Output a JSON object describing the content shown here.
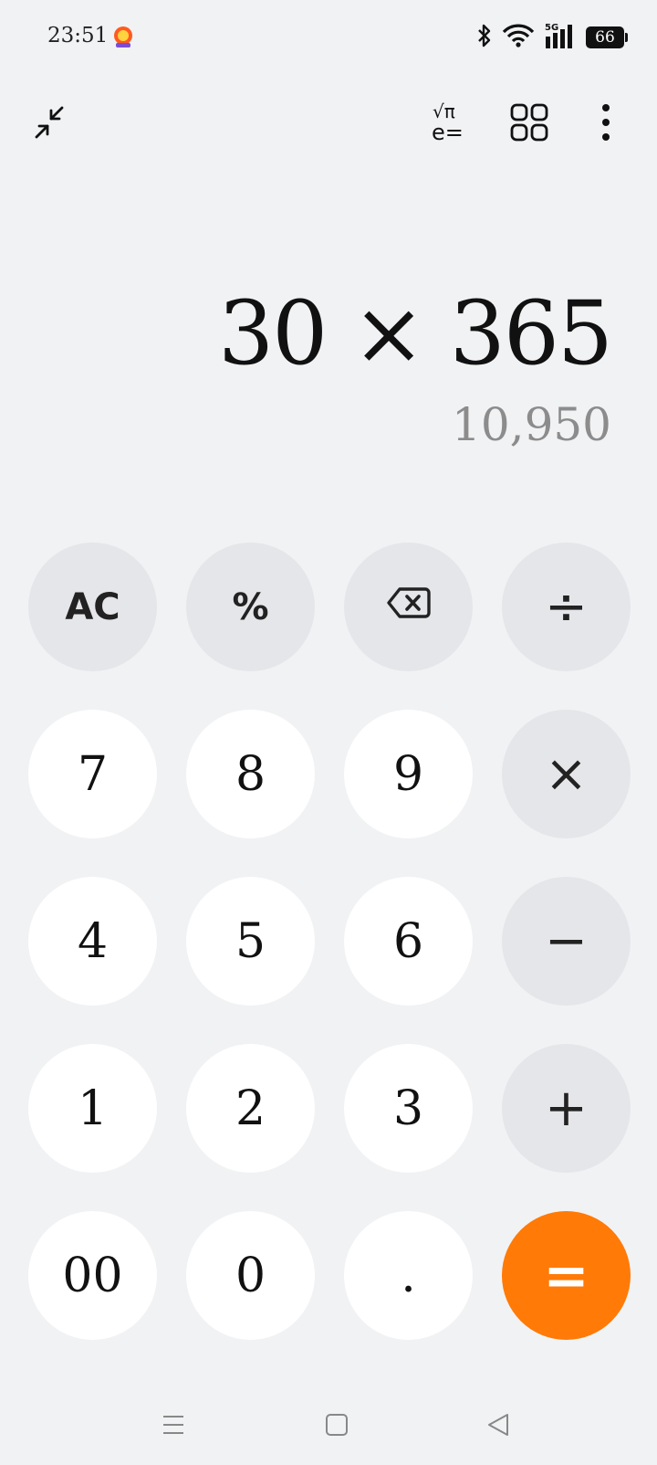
{
  "status_bar": {
    "time": "23:51",
    "battery": "66",
    "network": "5G",
    "icons": [
      "app-notification-icon",
      "bluetooth-icon",
      "wifi-icon",
      "signal-icon",
      "battery-icon"
    ]
  },
  "toolbar": {
    "icons": [
      "collapse-icon",
      "scientific-mode-icon",
      "converter-grid-icon",
      "more-options-icon"
    ],
    "sci_top": "√π",
    "sci_bottom": "e="
  },
  "display": {
    "expression": "30 × 365",
    "result": "10,950"
  },
  "keypad": {
    "keys": [
      {
        "label": "AC",
        "type": "func",
        "name": "clear"
      },
      {
        "label": "%",
        "type": "func",
        "name": "percent"
      },
      {
        "label": "",
        "type": "func",
        "name": "backspace",
        "icon": "backspace-icon"
      },
      {
        "label": "÷",
        "type": "op",
        "name": "divide"
      },
      {
        "label": "7",
        "type": "num",
        "name": "digit-7"
      },
      {
        "label": "8",
        "type": "num",
        "name": "digit-8"
      },
      {
        "label": "9",
        "type": "num",
        "name": "digit-9"
      },
      {
        "label": "×",
        "type": "op",
        "name": "multiply"
      },
      {
        "label": "4",
        "type": "num",
        "name": "digit-4"
      },
      {
        "label": "5",
        "type": "num",
        "name": "digit-5"
      },
      {
        "label": "6",
        "type": "num",
        "name": "digit-6"
      },
      {
        "label": "−",
        "type": "op",
        "name": "subtract"
      },
      {
        "label": "1",
        "type": "num",
        "name": "digit-1"
      },
      {
        "label": "2",
        "type": "num",
        "name": "digit-2"
      },
      {
        "label": "3",
        "type": "num",
        "name": "digit-3"
      },
      {
        "label": "+",
        "type": "op",
        "name": "add"
      },
      {
        "label": "00",
        "type": "num",
        "name": "double-zero"
      },
      {
        "label": "0",
        "type": "num",
        "name": "digit-0"
      },
      {
        "label": ".",
        "type": "num",
        "name": "decimal"
      },
      {
        "label": "=",
        "type": "equals",
        "name": "equals"
      }
    ]
  },
  "nav_bar": {
    "icons": [
      "recent-apps-icon",
      "home-icon",
      "back-icon"
    ]
  },
  "colors": {
    "background": "#f1f2f4",
    "number_key": "#ffffff",
    "function_key": "#e5e6e9",
    "accent": "#ff7a06",
    "result_text": "#8c8c8c"
  }
}
